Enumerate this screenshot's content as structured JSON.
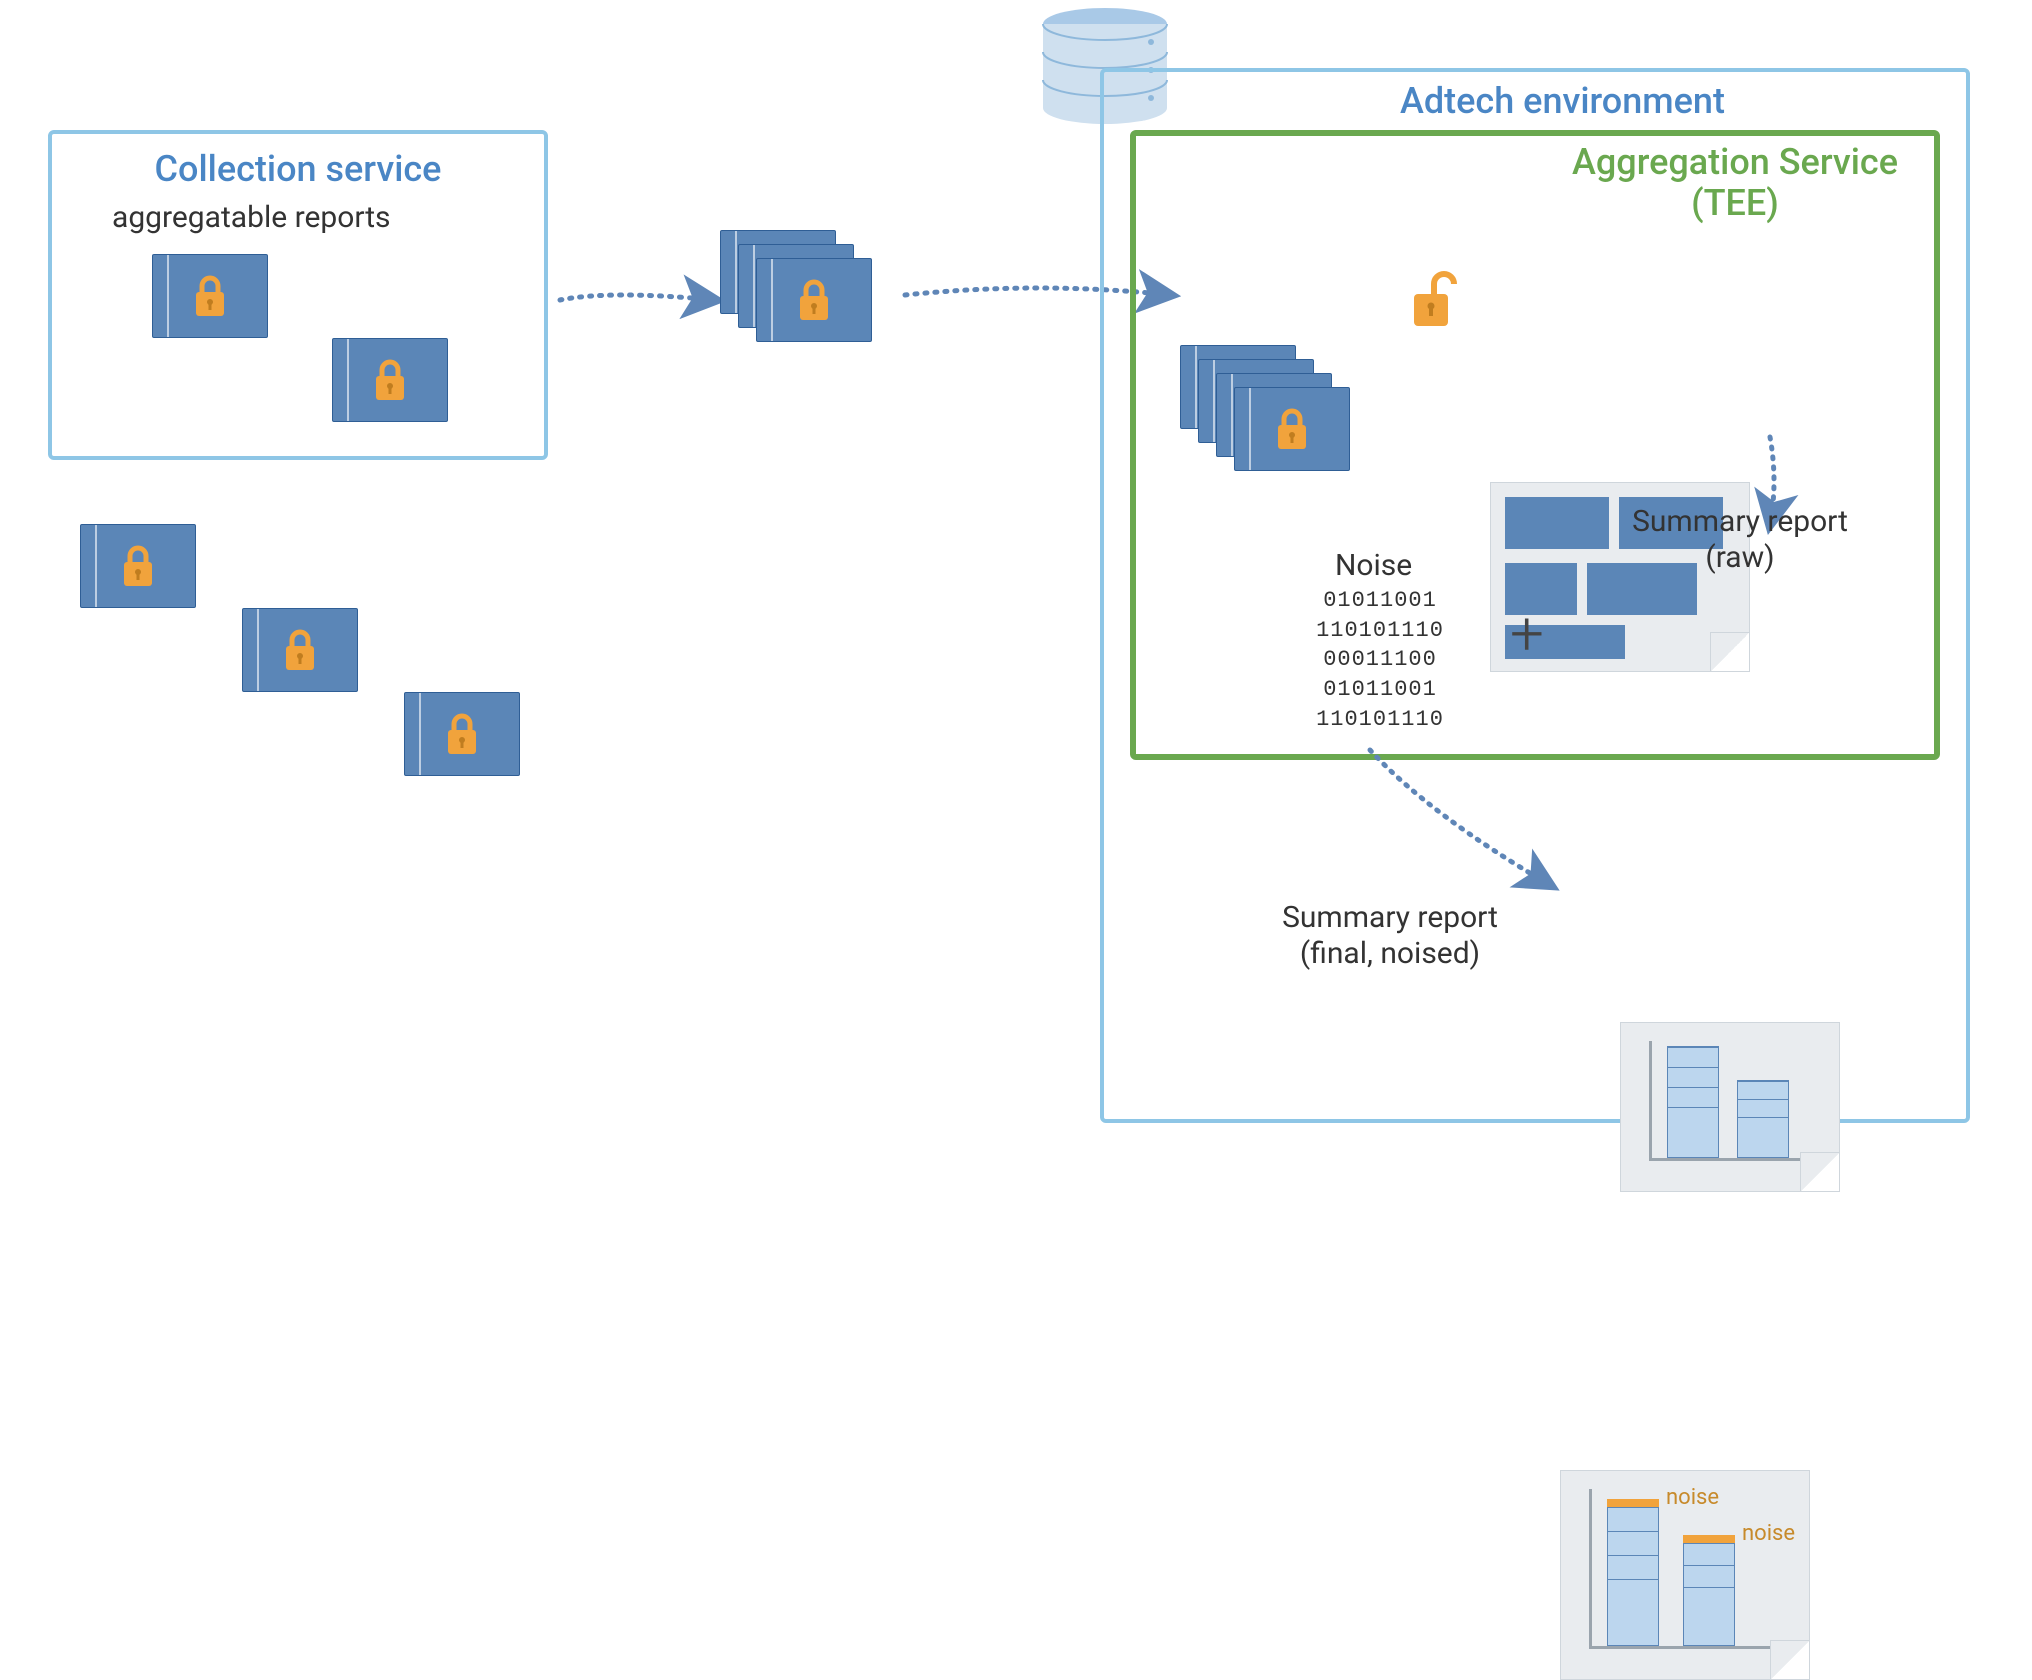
{
  "collection": {
    "title": "Collection service",
    "subtitle": "aggregatable reports"
  },
  "adtech": {
    "title": "Adtech environment"
  },
  "aggregation": {
    "title_line1": "Aggregation Service",
    "title_line2": "(TEE)"
  },
  "noise": {
    "label": "Noise",
    "bits": {
      "l1": "01011001",
      "l2": "110101110",
      "l3": "00011100",
      "l4": "01011001",
      "l5": "110101110"
    }
  },
  "plus": "+",
  "summary_raw": {
    "line1": "Summary report",
    "line2": "(raw)"
  },
  "summary_final": {
    "line1": "Summary report",
    "line2": "(final, noised)",
    "noise_caption": "noise"
  },
  "icons": {
    "database": "database-icon",
    "lock_closed": "lock-closed-icon",
    "lock_open": "lock-open-icon"
  },
  "colors": {
    "blue_border": "#8ec6e6",
    "blue_fill": "#5b86b7",
    "green": "#6aa84f",
    "orange": "#f1a33c",
    "title_blue": "#4a86c5"
  }
}
